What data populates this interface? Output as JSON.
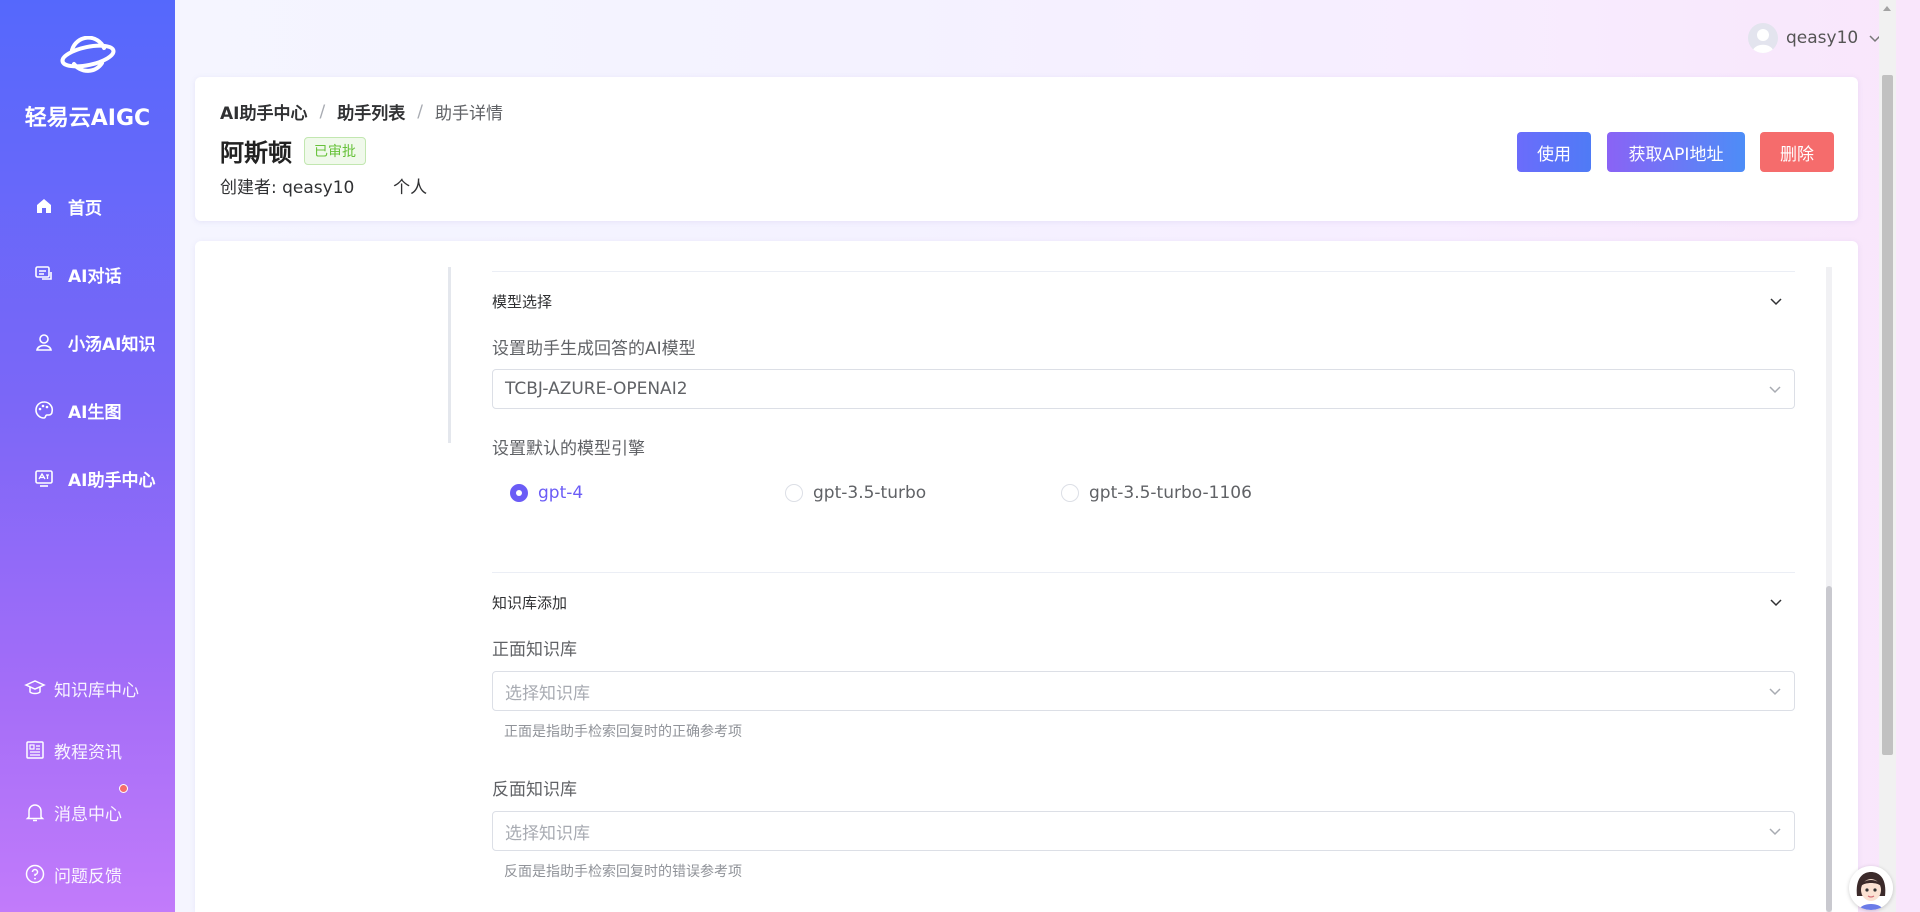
{
  "sidebar": {
    "brand": "轻易云AIGC",
    "nav": [
      {
        "label": "首页",
        "icon": "home-icon"
      },
      {
        "label": "AI对话",
        "icon": "chat-icon"
      },
      {
        "label": "小汤AI知识",
        "icon": "person-icon"
      },
      {
        "label": "AI生图",
        "icon": "palette-icon"
      },
      {
        "label": "AI助手中心",
        "icon": "assistant-icon"
      }
    ],
    "bottom": [
      {
        "label": "知识库中心",
        "icon": "graduation-cap-icon"
      },
      {
        "label": "教程资讯",
        "icon": "news-icon"
      },
      {
        "label": "消息中心",
        "icon": "bell-icon"
      },
      {
        "label": "问题反馈",
        "icon": "question-icon"
      }
    ]
  },
  "user": {
    "name": "qeasy10"
  },
  "header": {
    "breadcrumb": [
      "AI助手中心",
      "助手列表",
      "助手详情"
    ],
    "title": "阿斯顿",
    "status": "已审批",
    "creator_label": "创建者:",
    "creator_name": "qeasy10",
    "scope": "个人",
    "buttons": {
      "use": "使用",
      "api": "获取API地址",
      "delete": "删除"
    }
  },
  "model_section": {
    "title": "模型选择",
    "model_label": "设置助手生成回答的AI模型",
    "model_value": "TCBJ-AZURE-OPENAI2",
    "engine_label": "设置默认的模型引擎",
    "engines": [
      {
        "label": "gpt-4",
        "checked": true
      },
      {
        "label": "gpt-3.5-turbo",
        "checked": false
      },
      {
        "label": "gpt-3.5-turbo-1106",
        "checked": false
      }
    ]
  },
  "knowledge_section": {
    "title": "知识库添加",
    "positive_label": "正面知识库",
    "positive_placeholder": "选择知识库",
    "positive_hint": "正面是指助手检索回复时的正确参考项",
    "negative_label": "反面知识库",
    "negative_placeholder": "选择知识库",
    "negative_hint": "反面是指助手检索回复时的错误参考项"
  },
  "colors": {
    "accent": "#6b5cf6",
    "danger": "#f56c6c",
    "success": "#67c23a"
  }
}
